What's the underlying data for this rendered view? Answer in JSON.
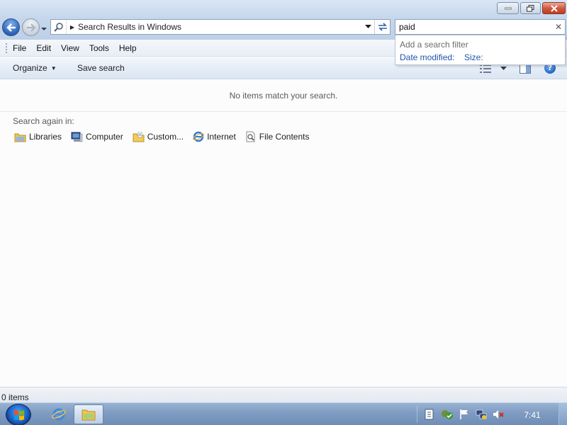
{
  "window": {
    "caption_buttons": [
      "minimize",
      "restore",
      "close"
    ]
  },
  "address_bar": {
    "path": "Search Results in Windows",
    "icon": "search-icon"
  },
  "search": {
    "value": "paid",
    "dropdown": {
      "title": "Add a search filter",
      "filters": [
        "Date modified:",
        "Size:"
      ]
    }
  },
  "menu": {
    "items": [
      "File",
      "Edit",
      "View",
      "Tools",
      "Help"
    ]
  },
  "command_bar": {
    "organize": "Organize",
    "save_search": "Save search",
    "help_icon": "?"
  },
  "content": {
    "empty_message": "No items match your search.",
    "search_again_label": "Search again in:",
    "search_again_items": [
      {
        "label": "Libraries",
        "icon": "libraries-icon"
      },
      {
        "label": "Computer",
        "icon": "computer-icon"
      },
      {
        "label": "Custom...",
        "icon": "custom-folder-icon"
      },
      {
        "label": "Internet",
        "icon": "internet-explorer-icon"
      },
      {
        "label": "File Contents",
        "icon": "file-contents-icon"
      }
    ]
  },
  "status_bar": {
    "text": "0 items"
  },
  "taskbar": {
    "pinned": [
      "internet-explorer-icon",
      "windows-explorer-icon"
    ],
    "tray_icons": [
      "action-center-icon",
      "security-shield-icon",
      "flag-icon",
      "network-icon",
      "volume-muted-icon"
    ],
    "clock": "7:41"
  },
  "colors": {
    "link_blue": "#1f55a8",
    "frame_blue": "#c6d7ec",
    "taskbar_blue": "#7f9cc2"
  }
}
